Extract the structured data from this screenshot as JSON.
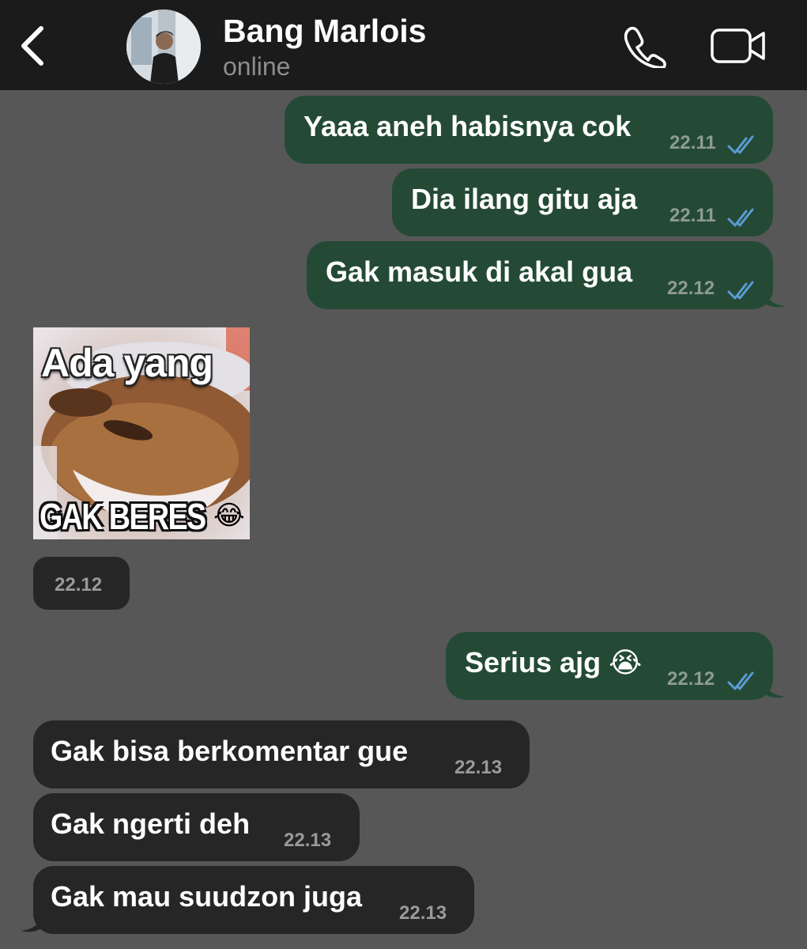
{
  "header": {
    "contact_name": "Bang Marlois",
    "status": "online",
    "back_icon": "chevron-left-icon",
    "call_icon": "phone-icon",
    "video_icon": "video-camera-icon"
  },
  "colors": {
    "header_bg": "#1b1b1b",
    "chat_bg": "#575757",
    "outgoing_bubble": "#244a36",
    "incoming_bubble": "#262626",
    "read_ticks": "#5b9bd5"
  },
  "messages": [
    {
      "direction": "outgoing",
      "text": "Yaaa aneh habisnya cok",
      "time": "22.11",
      "status": "read"
    },
    {
      "direction": "outgoing",
      "text": "Dia ilang gitu aja",
      "time": "22.11",
      "status": "read"
    },
    {
      "direction": "outgoing",
      "text": "Gak masuk di akal gua",
      "time": "22.12",
      "status": "read"
    },
    {
      "direction": "incoming",
      "type": "sticker",
      "sticker_top": "Ada yang",
      "sticker_bottom": "GAK BERES",
      "sticker_emoji": "😂",
      "time": "22.12"
    },
    {
      "direction": "outgoing",
      "text": "Serius ajg 😭",
      "time": "22.12",
      "status": "read"
    },
    {
      "direction": "incoming",
      "text": "Gak bisa berkomentar gue",
      "time": "22.13"
    },
    {
      "direction": "incoming",
      "text": "Gak ngerti deh",
      "time": "22.13"
    },
    {
      "direction": "incoming",
      "text": "Gak mau suudzon juga",
      "time": "22.13"
    }
  ]
}
